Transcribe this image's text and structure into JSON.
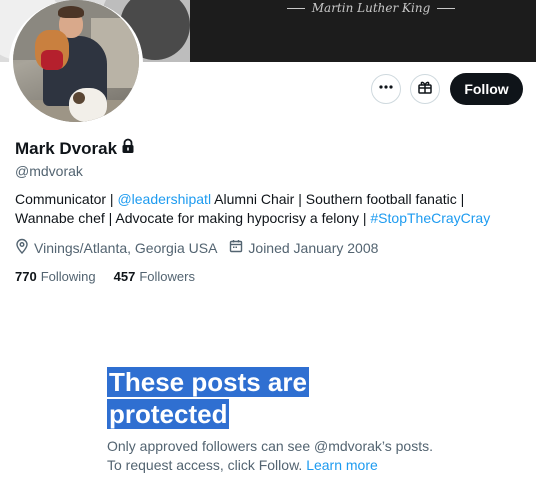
{
  "banner": {
    "quote_attribution": "Martin Luther King"
  },
  "profile": {
    "display_name": "Mark Dvorak",
    "handle": "@mdvorak",
    "bio_parts": {
      "p1": "Communicator | ",
      "link1": "@leadershipatl",
      "p2": " Alumni Chair | Southern football fanatic | Wannabe chef | Advocate for making hypocrisy a felony | ",
      "link2": "#StopTheCrayCray"
    },
    "location": "Vinings/Atlanta, Georgia USA",
    "joined": "Joined January 2008",
    "following_count": "770",
    "following_label": "Following",
    "followers_count": "457",
    "followers_label": "Followers"
  },
  "actions": {
    "more_icon": "ellipsis-icon",
    "gift_icon": "gift-icon",
    "follow_label": "Follow"
  },
  "protected": {
    "title": "These posts are protected",
    "line1": "Only approved followers can see @mdvorak’s posts.",
    "line2": "To request access, click Follow. ",
    "learn_more": "Learn more"
  },
  "colors": {
    "accent": "#1d9bf0",
    "text_primary": "#0f1419",
    "text_secondary": "#536471",
    "follow_bg": "#0f1419",
    "highlight": "#2f6fd1"
  }
}
